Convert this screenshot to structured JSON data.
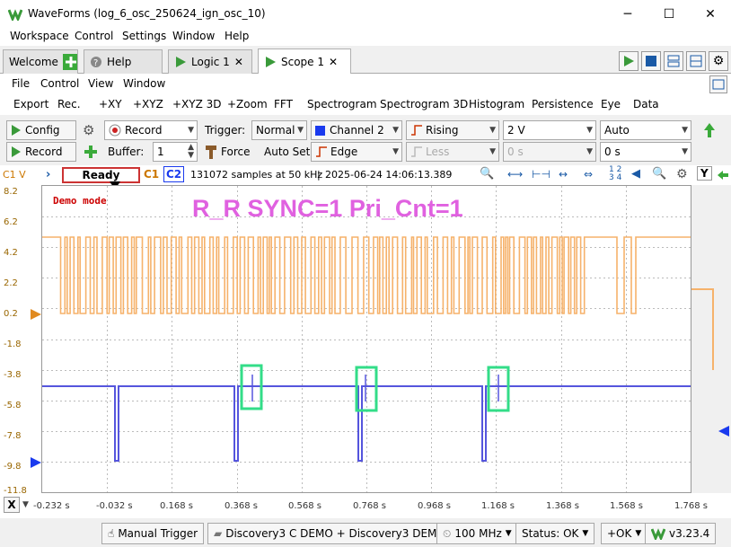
{
  "window": {
    "title": "WaveForms (log_6_osc_250624_ign_osc_10)",
    "minimize": "─",
    "maximize": "☐",
    "close": "✕"
  },
  "menu": [
    "Workspace",
    "Control",
    "Settings",
    "Window",
    "Help"
  ],
  "tabs": [
    {
      "label": "Welcome",
      "icon": "plus-icon"
    },
    {
      "label": "Help",
      "icon": "help-icon"
    },
    {
      "label": "Logic 1",
      "icon": "play-icon"
    },
    {
      "label": "Scope 1",
      "icon": "play-icon"
    }
  ],
  "scope_menu": [
    "File",
    "Control",
    "View",
    "Window"
  ],
  "scope_tools": [
    "Export",
    "Rec.",
    "+XY",
    "+XYZ",
    "+XYZ 3D",
    "+Zoom",
    "FFT",
    "Spectrogram",
    "Spectrogram 3D",
    "Histogram",
    "Persistence",
    "Eye",
    "Data"
  ],
  "controls": {
    "config": "Config",
    "record_mode": "Record",
    "record_btn": "Record",
    "buffer_label": "Buffer:",
    "buffer_value": "1",
    "force": "Force",
    "trigger_label": "Trigger:",
    "trigger_mode": "Normal",
    "auto_set": "Auto Set",
    "channel": "Channel 2",
    "trigger_type": "Edge",
    "edge": "Rising",
    "less": "Less",
    "level": "2 V",
    "hold": "0 s",
    "auto": "Auto",
    "position": "0 s"
  },
  "status": {
    "chan": "C1 V",
    "state": "Ready",
    "c1": "C1",
    "c2": "C2",
    "info": "131072 samples at 50 kHz",
    "timestamp": "2025-06-24 14:06:13.389",
    "y_btn": "Y"
  },
  "plot": {
    "demo": "Demo mode",
    "annotation": "R_R SYNC=1 Pri_Cnt=1",
    "y_ticks": [
      "8.2",
      "6.2",
      "4.2",
      "2.2",
      "0.2",
      "-1.8",
      "-3.8",
      "-5.8",
      "-7.8",
      "-9.8",
      "-11.8"
    ],
    "x_ticks": [
      "-0.232 s",
      "-0.032 s",
      "0.168 s",
      "0.368 s",
      "0.568 s",
      "0.768 s",
      "0.968 s",
      "1.168 s",
      "1.368 s",
      "1.568 s",
      "1.768 s"
    ],
    "x_label": "X",
    "colors": {
      "ch1": "#f6b26b",
      "ch2": "#5555dd",
      "annotation": "#e061e0",
      "box": "#33dd88",
      "demo": "#cc0000"
    }
  },
  "bottom": {
    "manual_trigger": "Manual Trigger",
    "device": "Discovery3 C DEMO + Discovery3 DEMO",
    "freq": "100 MHz",
    "status": "Status: OK",
    "ok": "+OK",
    "version": "v3.23.4"
  }
}
